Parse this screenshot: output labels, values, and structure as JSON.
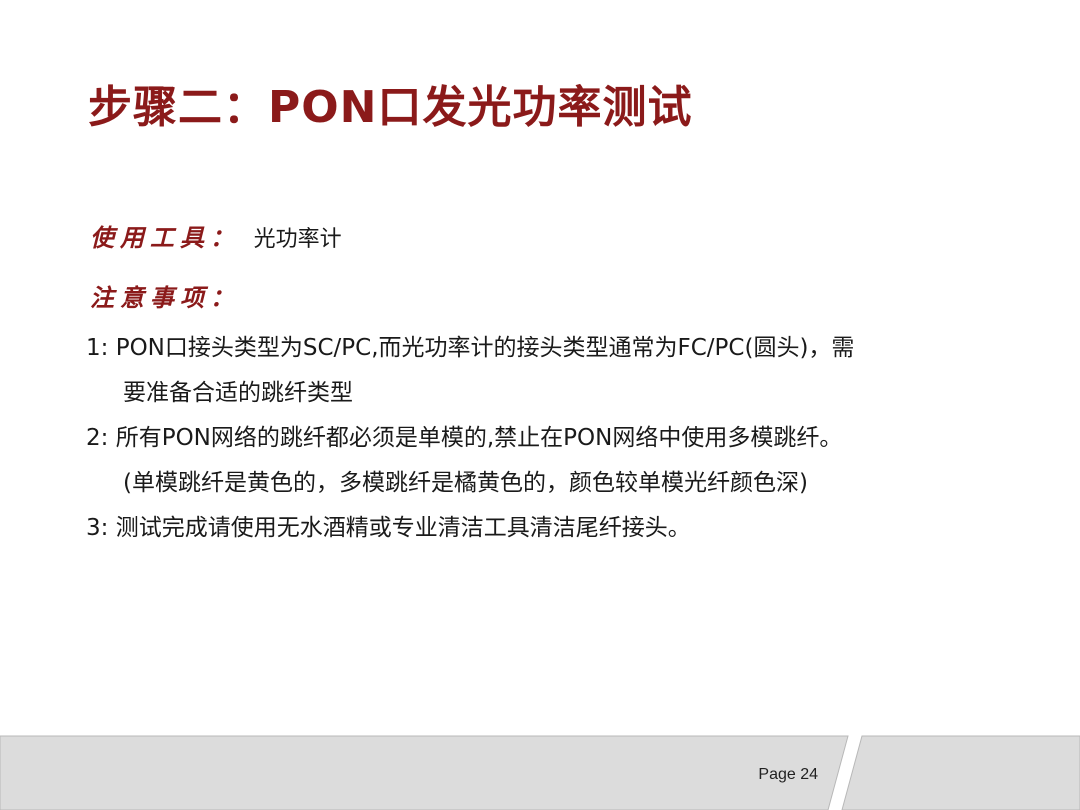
{
  "slide": {
    "title": "步骤二：PON口发光功率测试",
    "tools_label": "使用工具：",
    "tools_value": "光功率计",
    "notes_label": "注意事项：",
    "notes": [
      {
        "text": "1:  PON口接头类型为SC/PC,而光功率计的接头类型通常为FC/PC(圆头)，需",
        "cont": false
      },
      {
        "text": "要准备合适的跳纤类型",
        "cont": true
      },
      {
        "text": "2:  所有PON网络的跳纤都必须是单模的,禁止在PON网络中使用多模跳纤。",
        "cont": false
      },
      {
        "text": "(单模跳纤是黄色的，多模跳纤是橘黄色的，颜色较单模光纤颜色深)",
        "cont": true
      },
      {
        "text": "3:  测试完成请使用无水酒精或专业清洁工具清洁尾纤接头。",
        "cont": false
      }
    ]
  },
  "footer": {
    "page_label": "Page 24"
  },
  "colors": {
    "title": "#8b1a1a",
    "footer_fill": "#dcdcdc",
    "footer_line": "#b0b0b0"
  }
}
